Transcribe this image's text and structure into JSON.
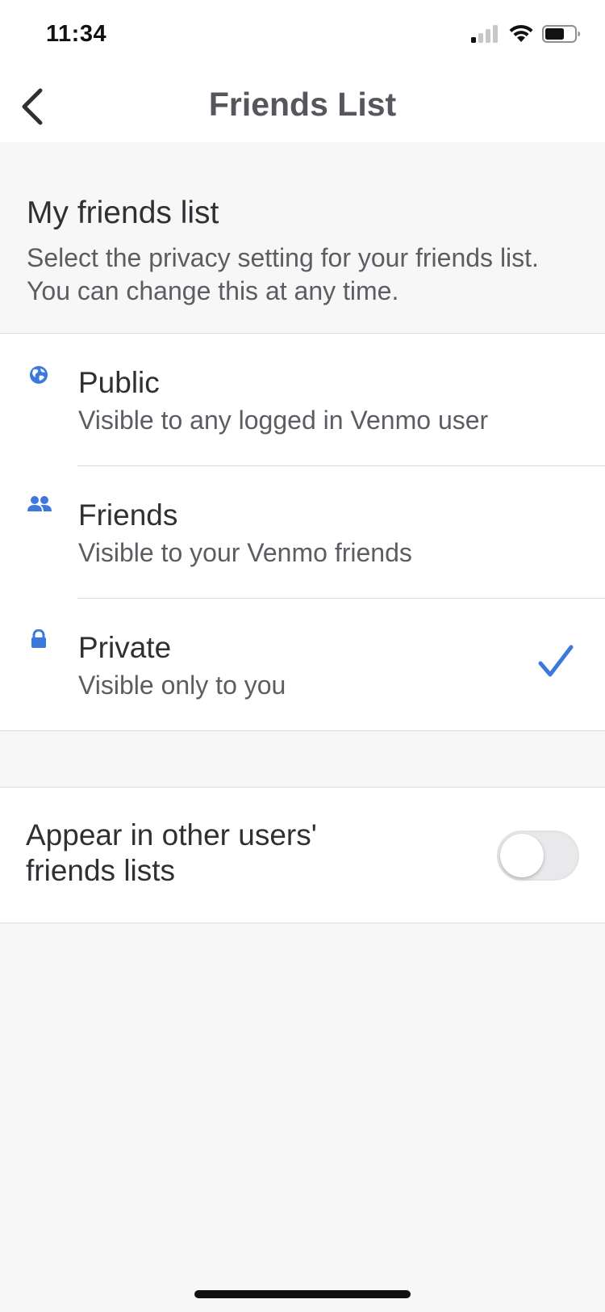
{
  "status_bar": {
    "time": "11:34",
    "icons": [
      "cellular-signal-icon",
      "wifi-icon",
      "battery-icon"
    ]
  },
  "nav": {
    "title": "Friends List",
    "back_icon": "chevron-left-icon"
  },
  "intro": {
    "heading": "My friends list",
    "description": "Select the privacy setting for your friends list. You can change this at any time."
  },
  "options": [
    {
      "icon": "globe-icon",
      "title": "Public",
      "subtitle": "Visible to any logged in Venmo user",
      "selected": false
    },
    {
      "icon": "people-icon",
      "title": "Friends",
      "subtitle": "Visible to your Venmo friends",
      "selected": false
    },
    {
      "icon": "lock-icon",
      "title": "Private",
      "subtitle": "Visible only to you",
      "selected": true
    }
  ],
  "appear_setting": {
    "label": "Appear in other users' friends lists",
    "enabled": false
  },
  "colors": {
    "accent": "#3d78dc",
    "background": "#f7f7f7",
    "surface": "#ffffff",
    "title_text": "#55575c"
  }
}
